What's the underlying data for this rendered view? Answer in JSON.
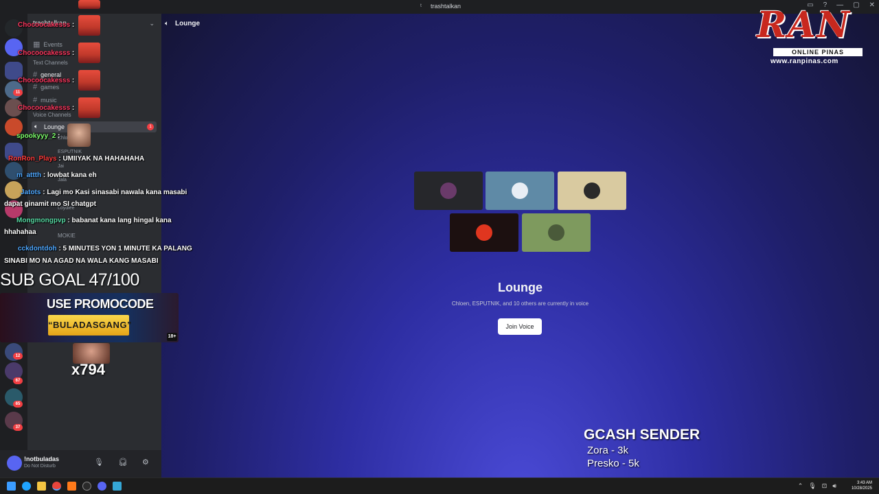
{
  "window": {
    "title": "trashtalkan"
  },
  "guild": {
    "name": "trashtalkan"
  },
  "channels": {
    "events": "Events",
    "text_category": "Text Channels",
    "text": [
      "general",
      "games",
      "music"
    ],
    "voice_category": "Voice Channels",
    "voice_active": "Lounge",
    "voice_badge": "1",
    "voice_users": [
      "Chloen",
      "ESPUTNIK",
      "Jai",
      "Jala",
      "Loydiee",
      "MOKIE"
    ]
  },
  "rail": {
    "badges": [
      "11",
      "12",
      "67",
      "65",
      "37"
    ]
  },
  "user": {
    "name": "!notbuladas",
    "status": "Do Not Disturb"
  },
  "voice_channel": {
    "header": "Lounge",
    "title": "Lounge",
    "subtitle": "Chloen, ESPUTNIK, and 10 others are currently in voice",
    "join_label": "Join Voice",
    "tile_colors": [
      "#26272b",
      "#5f8aa6",
      "#d9caa0",
      "#1c1010",
      "#7e9a5e"
    ]
  },
  "chat": [
    {
      "user": "Chocoocakesss",
      "color": "#ff3860",
      "text": " :"
    },
    {
      "user": "Chocoocakesss",
      "color": "#ff3860",
      "text": " :"
    },
    {
      "user": "Chocoocakesss",
      "color": "#ff3860",
      "text": " :"
    },
    {
      "user": "Chocoocakesss",
      "color": "#ff3860",
      "text": " :"
    },
    {
      "user": "spookyyy_2",
      "color": "#7cff6b",
      "text": " :"
    },
    {
      "user": "RonRon_Plays",
      "color": "#ff3c3c",
      "text": " : UMIIYAK NA HAHAHAHA"
    },
    {
      "user": "m_attth",
      "color": "#4fa8ff",
      "text": " : lowbat kana eh"
    },
    {
      "user": "Jatots",
      "color": "#4fa8ff",
      "text": " : Lagi mo Kasi sinasabi nawala kana masabi"
    },
    {
      "user": "",
      "color": "#ffffff",
      "text": "dapat ginamit mo SI chatgpt"
    },
    {
      "user": "Mongmongpvp",
      "color": "#57d9a3",
      "text": " : babanat kana lang hingal kana"
    },
    {
      "user": "",
      "color": "#ffffff",
      "text": "hhahahaa"
    },
    {
      "user": "cckdontdoh",
      "color": "#4fa8ff",
      "text": " : 5 MINUTES YON 1 MINUTE KA PALANG"
    },
    {
      "user": "",
      "color": "#ffffff",
      "text": "SINABI MO NA AGAD NA WALA KANG MASABI"
    }
  ],
  "overlay": {
    "sub_goal": "SUB GOAL 47/100",
    "promo_line1": "USE PROMOCODE",
    "promo_code": "“BULADASGANG”",
    "promo_age": "18+",
    "emote_count": "x794",
    "logo_text": "RAN",
    "logo_bar": "ONLINE PINAS",
    "logo_url": "www.ranpinas.com",
    "gcash_title": "GCASH SENDER",
    "gcash_items": [
      "Zora - 3k",
      "Presko - 5k"
    ]
  },
  "taskbar": {
    "time": "3:43 AM",
    "date": "10/28/2025"
  }
}
